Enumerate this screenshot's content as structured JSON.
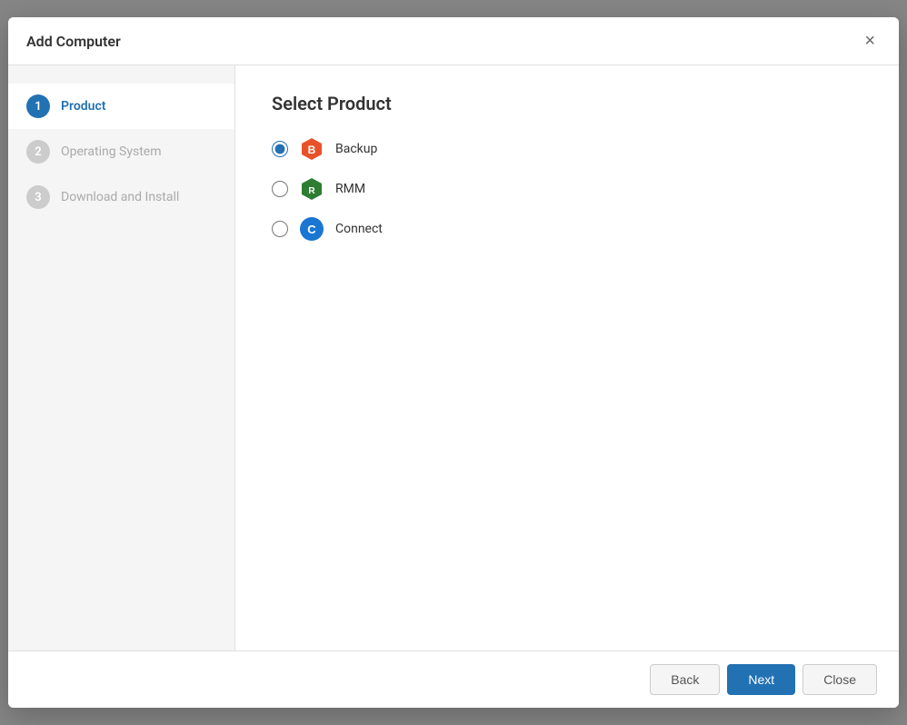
{
  "modal": {
    "title": "Add Computer",
    "close_label": "×"
  },
  "sidebar": {
    "steps": [
      {
        "id": "product",
        "number": "1",
        "label": "Product",
        "state": "active"
      },
      {
        "id": "os",
        "number": "2",
        "label": "Operating System",
        "state": "inactive"
      },
      {
        "id": "download",
        "number": "3",
        "label": "Download and Install",
        "state": "inactive"
      }
    ]
  },
  "main": {
    "section_title": "Select Product",
    "products": [
      {
        "id": "backup",
        "name": "Backup",
        "selected": true
      },
      {
        "id": "rmm",
        "name": "RMM",
        "selected": false
      },
      {
        "id": "connect",
        "name": "Connect",
        "selected": false
      }
    ]
  },
  "footer": {
    "back_label": "Back",
    "next_label": "Next",
    "close_label": "Close"
  }
}
